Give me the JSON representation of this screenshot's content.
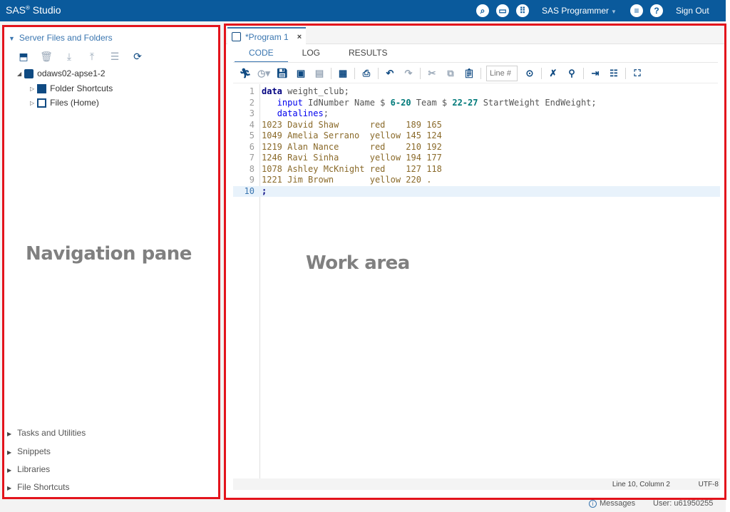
{
  "header": {
    "app_title": "SAS",
    "app_title_sup": "®",
    "app_title_suffix": " Studio",
    "icons": [
      "search-icon",
      "folder-open-icon",
      "apps-grid-icon",
      "menu-icon",
      "help-icon"
    ],
    "role": "SAS Programmer",
    "sign_out": "Sign Out"
  },
  "navigation": {
    "section_title": "Server Files and Folders",
    "toolbar_icons": [
      "new-item-icon",
      "delete-icon",
      "download-icon",
      "upload-icon",
      "properties-icon",
      "refresh-icon"
    ],
    "tree": [
      {
        "label": "odaws02-apse1-2",
        "icon": "server-icon",
        "expanded": true
      },
      {
        "label": "Folder Shortcuts",
        "icon": "folder-shortcut-icon",
        "expanded": false
      },
      {
        "label": "Files (Home)",
        "icon": "home-files-icon",
        "expanded": false
      }
    ],
    "bottom_sections": [
      "Tasks and Utilities",
      "Snippets",
      "Libraries",
      "File Shortcuts"
    ],
    "annotation": "Navigation pane"
  },
  "work_area": {
    "annotation": "Work area",
    "tab": {
      "label": "*Program 1",
      "close": "×"
    },
    "subtabs": [
      "CODE",
      "LOG",
      "RESULTS"
    ],
    "active_subtab": "CODE",
    "line_input_placeholder": "Line #",
    "code_lines": [
      {
        "n": "1",
        "parts": [
          [
            "kw",
            "data"
          ],
          [
            "",
            " weight_club;"
          ]
        ]
      },
      {
        "n": "2",
        "parts": [
          [
            "",
            "   "
          ],
          [
            "kw2",
            "input"
          ],
          [
            "",
            " IdNumber Name $ "
          ],
          [
            "num",
            "6-20"
          ],
          [
            "",
            " Team $ "
          ],
          [
            "num",
            "22-27"
          ],
          [
            "",
            " StartWeight EndWeight;"
          ]
        ]
      },
      {
        "n": "3",
        "parts": [
          [
            "",
            "   "
          ],
          [
            "kw2",
            "datalines"
          ],
          [
            "",
            ";"
          ]
        ]
      },
      {
        "n": "4",
        "parts": [
          [
            "dat",
            "1023 David Shaw      red    189 165"
          ]
        ]
      },
      {
        "n": "5",
        "parts": [
          [
            "dat",
            "1049 Amelia Serrano  yellow 145 124"
          ]
        ]
      },
      {
        "n": "6",
        "parts": [
          [
            "dat",
            "1219 Alan Nance      red    210 192"
          ]
        ]
      },
      {
        "n": "7",
        "parts": [
          [
            "dat",
            "1246 Ravi Sinha      yellow 194 177"
          ]
        ]
      },
      {
        "n": "8",
        "parts": [
          [
            "dat",
            "1078 Ashley McKnight red    127 118"
          ]
        ]
      },
      {
        "n": "9",
        "parts": [
          [
            "dat",
            "1221 Jim Brown       yellow 220 ."
          ]
        ]
      },
      {
        "n": "10",
        "parts": [
          [
            "kw",
            ";"
          ]
        ],
        "current": true
      }
    ],
    "status_position": "Line 10, Column 2",
    "status_encoding": "UTF-8"
  },
  "footer": {
    "messages": "Messages",
    "user": "User: u61950255"
  }
}
